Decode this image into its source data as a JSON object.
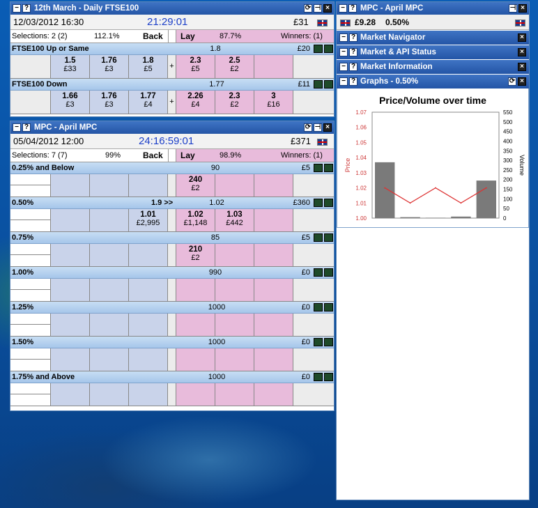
{
  "win1": {
    "title": "12th March - Daily FTSE100",
    "date": "12/03/2012  16:30",
    "time": "21:29:01",
    "amount": "£31",
    "sel": "Selections: 2 (2)",
    "pct_back": "112.1%",
    "back": "Back",
    "lay": "Lay",
    "pct_lay": "87.7%",
    "winners": "Winners: (1)",
    "markets": [
      {
        "name": "FTSE100 Up or Same",
        "ltp": "1.8",
        "matched": "£20",
        "back": [
          {
            "p": "1.5",
            "s": "£33"
          },
          {
            "p": "1.76",
            "s": "£3"
          },
          {
            "p": "1.8",
            "s": "£5"
          }
        ],
        "lay": [
          {
            "p": "2.3",
            "s": "£5"
          },
          {
            "p": "2.5",
            "s": "£2"
          },
          {
            "p": "",
            "s": ""
          }
        ]
      },
      {
        "name": "FTSE100 Down",
        "ltp": "1.77",
        "matched": "£11",
        "back": [
          {
            "p": "1.66",
            "s": "£3"
          },
          {
            "p": "1.76",
            "s": "£3"
          },
          {
            "p": "1.77",
            "s": "£4"
          }
        ],
        "lay": [
          {
            "p": "2.26",
            "s": "£4"
          },
          {
            "p": "2.3",
            "s": "£2"
          },
          {
            "p": "3",
            "s": "£16"
          }
        ]
      }
    ]
  },
  "win2": {
    "title": "MPC - April MPC",
    "date": "05/04/2012  12:00",
    "time": "24:16:59:01",
    "amount": "£371",
    "sel": "Selections: 7 (7)",
    "pct_back": "99%",
    "back": "Back",
    "lay": "Lay",
    "pct_lay": "98.9%",
    "winners": "Winners: (1)",
    "markets": [
      {
        "name": "0.25% and Below",
        "mid": "",
        "ltp": "90",
        "matched": "£5",
        "b": [
          "",
          "",
          ""
        ],
        "bs": [
          "",
          "",
          ""
        ],
        "l": [
          "240",
          "",
          ""
        ],
        "ls": [
          "£2",
          "",
          ""
        ]
      },
      {
        "name": "0.50%",
        "mid": "1.9 >>",
        "ltp": "1.02",
        "matched": "£360",
        "b": [
          "",
          "",
          "1.01"
        ],
        "bs": [
          "",
          "",
          "£2,995"
        ],
        "l": [
          "1.02",
          "1.03",
          ""
        ],
        "ls": [
          "£1,148",
          "£442",
          ""
        ]
      },
      {
        "name": "0.75%",
        "mid": "",
        "ltp": "85",
        "matched": "£5",
        "b": [
          "",
          "",
          ""
        ],
        "bs": [
          "",
          "",
          ""
        ],
        "l": [
          "210",
          "",
          ""
        ],
        "ls": [
          "£2",
          "",
          ""
        ]
      },
      {
        "name": "1.00%",
        "mid": "",
        "ltp": "990",
        "matched": "£0",
        "b": [
          "",
          "",
          ""
        ],
        "bs": [
          "",
          "",
          ""
        ],
        "l": [
          "",
          "",
          ""
        ],
        "ls": [
          "",
          "",
          ""
        ]
      },
      {
        "name": "1.25%",
        "mid": "",
        "ltp": "1000",
        "matched": "£0",
        "b": [
          "",
          "",
          ""
        ],
        "bs": [
          "",
          "",
          ""
        ],
        "l": [
          "",
          "",
          ""
        ],
        "ls": [
          "",
          "",
          ""
        ]
      },
      {
        "name": "1.50%",
        "mid": "",
        "ltp": "1000",
        "matched": "£0",
        "b": [
          "",
          "",
          ""
        ],
        "bs": [
          "",
          "",
          ""
        ],
        "l": [
          "",
          "",
          ""
        ],
        "ls": [
          "",
          "",
          ""
        ]
      },
      {
        "name": "1.75% and Above",
        "mid": "",
        "ltp": "1000",
        "matched": "£0",
        "b": [
          "",
          "",
          ""
        ],
        "bs": [
          "",
          "",
          ""
        ],
        "l": [
          "",
          "",
          ""
        ],
        "ls": [
          "",
          "",
          ""
        ]
      }
    ]
  },
  "right": {
    "title": "MPC - April MPC",
    "balance": "£9.28",
    "pct": "0.50%",
    "panels": [
      "Market Navigator",
      "Market & API Status",
      "Market Information"
    ],
    "graph_title": "Graphs - 0.50%"
  },
  "chart_data": {
    "type": "bar",
    "title": "Price/Volume over time",
    "ylabel": "Price",
    "y2label": "Volume",
    "ylim": [
      1.0,
      1.07
    ],
    "y2lim": [
      0,
      550
    ],
    "yticks": [
      "1.07",
      "1.06",
      "1.05",
      "1.04",
      "1.03",
      "1.02",
      "1.01",
      "1.00"
    ],
    "y2ticks": [
      "550",
      "500",
      "450",
      "400",
      "350",
      "300",
      "250",
      "200",
      "150",
      "100",
      "50",
      "0"
    ],
    "volume": [
      290,
      5,
      2,
      8,
      195
    ],
    "price": [
      1.02,
      1.01,
      1.02,
      1.01,
      1.02
    ]
  },
  "colors": {
    "titlebar": "#2b5fb0",
    "back": "#c9d3ea",
    "lay": "#e8bbdb",
    "market": "#b7d2f0"
  }
}
